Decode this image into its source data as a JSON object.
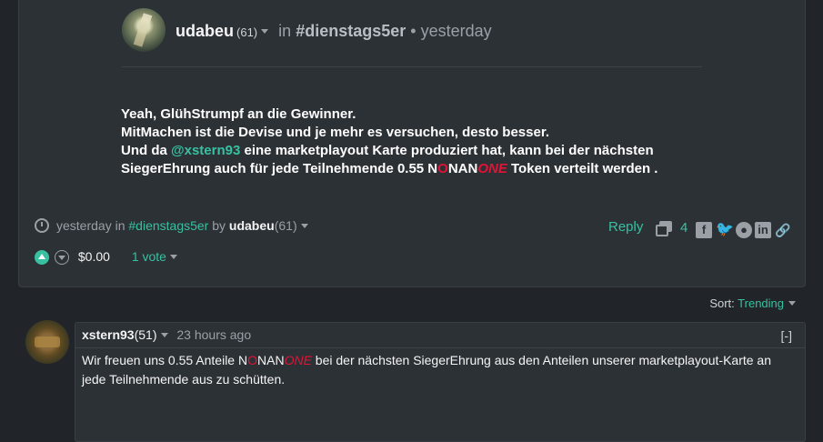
{
  "post": {
    "author": "udabeu",
    "reputation": "(61)",
    "in_word": "in",
    "community": "#dienstags5er",
    "separator": "•",
    "time": "yesterday",
    "body": {
      "line1": "Yeah, GlühStrumpf an die Gewinner.",
      "line2": "MitMachen ist die Devise und je mehr es versuchen, desto besser.",
      "line3_pre": "Und da ",
      "mention": "@xstern93",
      "line3_post": " eine marketplayout Karte produziert hat, kann bei der nächsten",
      "line4_pre": "SiegerEhrung auch für jede Teilnehmende 0.55 N",
      "line4_o": "O",
      "line4_nan": "NAN",
      "line4_one": "ONE",
      "line4_post": " Token verteilt werden ."
    },
    "meta": {
      "time": "yesterday",
      "in_word": "in",
      "community": "#dienstags5er",
      "by_word": "by",
      "author": "udabeu",
      "reputation": "(61)"
    },
    "reply_label": "Reply",
    "comment_count": "4",
    "share_icons": [
      "facebook-icon",
      "twitter-icon",
      "reddit-icon",
      "linkedin-icon",
      "link-icon"
    ],
    "payout": "$0.00",
    "votes_label": "1 vote"
  },
  "sort": {
    "label": "Sort:",
    "value": "Trending"
  },
  "comment": {
    "author": "xstern93",
    "reputation": "(51)",
    "time": "23 hours ago",
    "collapse": "[-]",
    "text_pre": "Wir freuen uns 0.55 Anteile N",
    "text_o": "O",
    "text_nan": "NAN",
    "text_one": "ONE",
    "text_post": " bei der nächsten SiegerEhrung aus den Anteilen unserer marketplayout-Karte an jede Teilnehmende aus zu schütten."
  },
  "colors": {
    "accent": "#37c1a0",
    "brand_red": "#e31337",
    "background": "#212529",
    "card": "#2c3136"
  }
}
